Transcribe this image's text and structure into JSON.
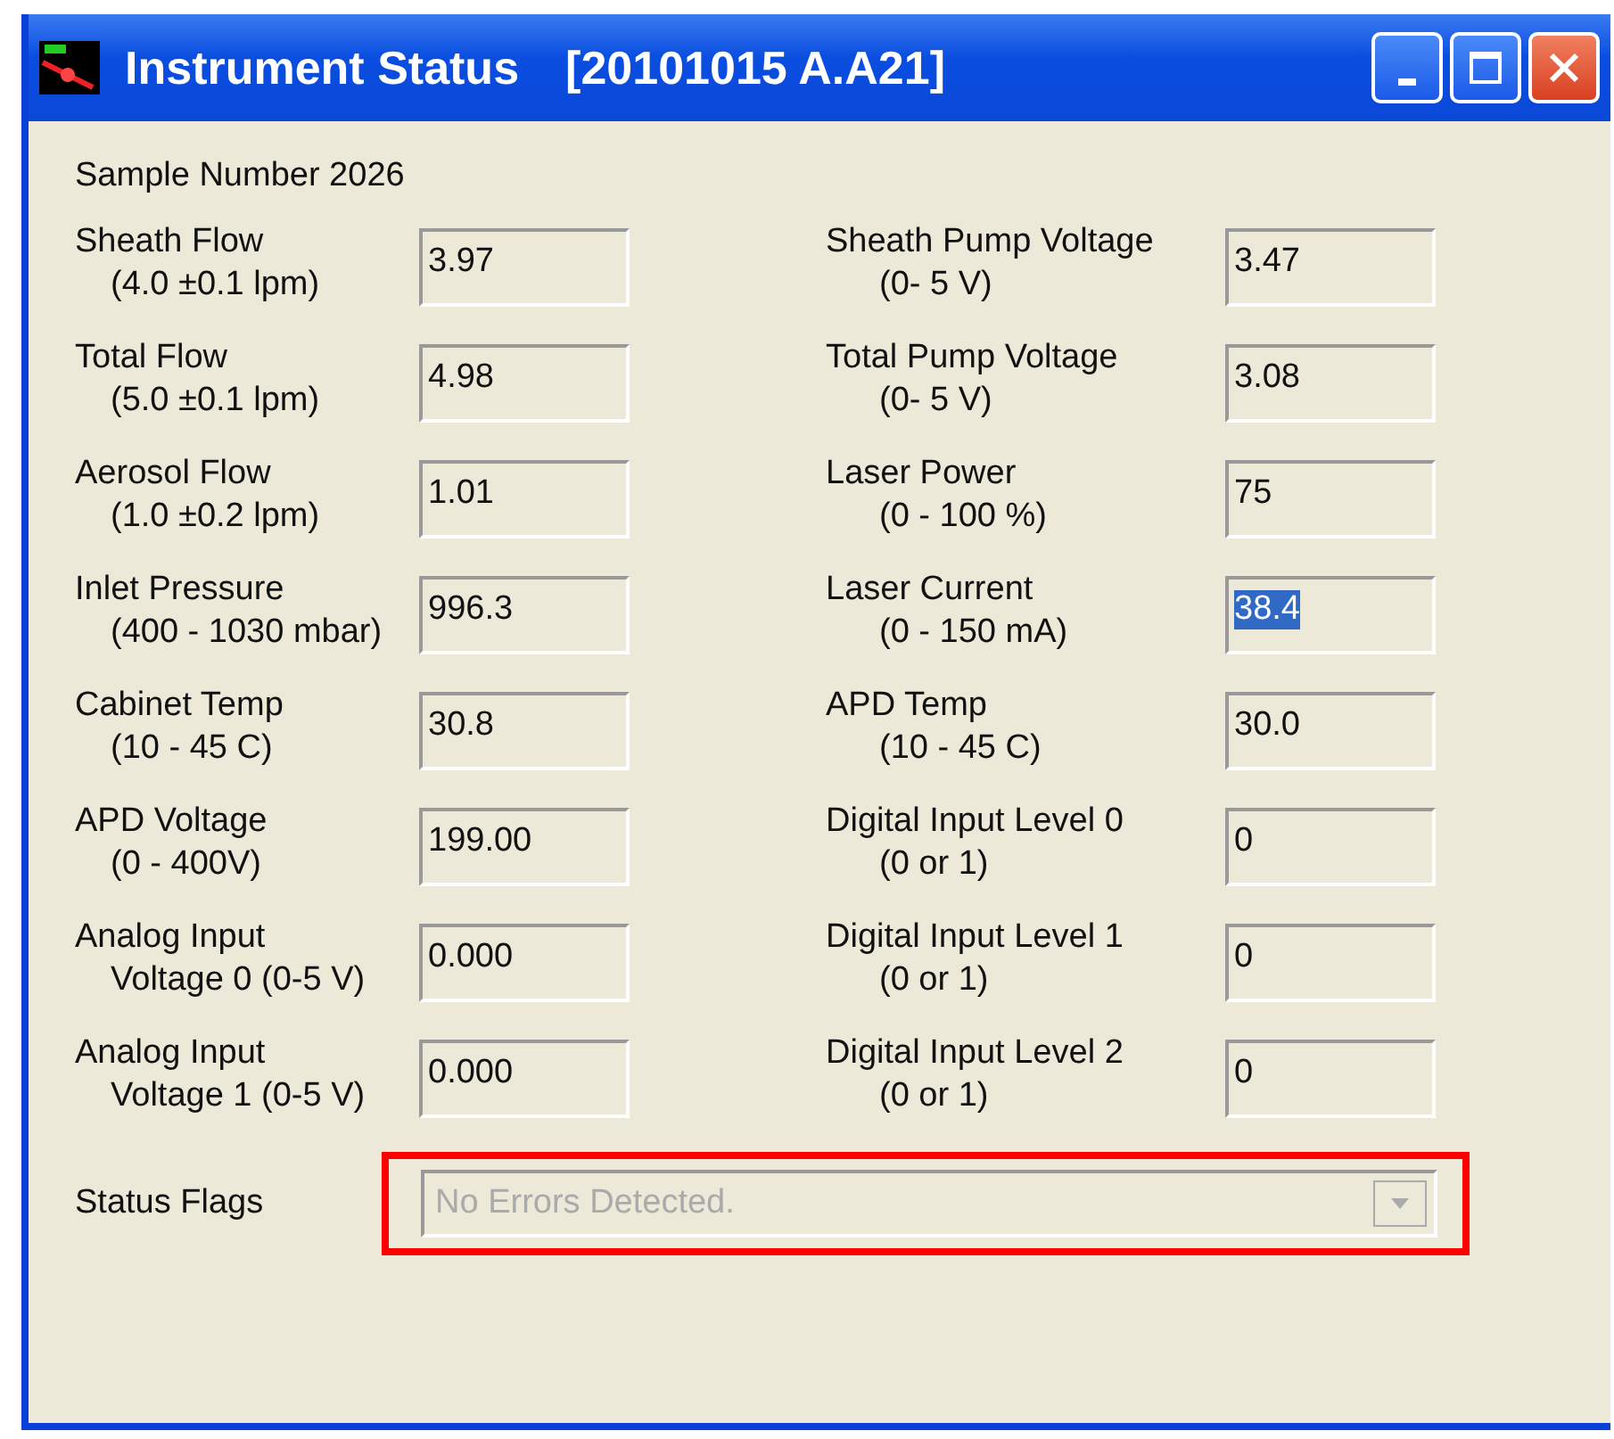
{
  "window": {
    "title": "Instrument Status",
    "subtitle": "[20101015 A.A21]"
  },
  "sample_number": "Sample Number 2026",
  "left_fields": [
    {
      "label": "Sheath Flow",
      "range": "(4.0 ±0.1 lpm)",
      "value": "3.97",
      "selected": false
    },
    {
      "label": "Total Flow",
      "range": "(5.0 ±0.1 lpm)",
      "value": "4.98",
      "selected": false
    },
    {
      "label": "Aerosol Flow",
      "range": "(1.0 ±0.2 lpm)",
      "value": "1.01",
      "selected": false
    },
    {
      "label": "Inlet Pressure",
      "range": "(400 - 1030 mbar)",
      "value": "996.3",
      "selected": false
    },
    {
      "label": "Cabinet Temp",
      "range": "(10 - 45 C)",
      "value": "30.8",
      "selected": false
    },
    {
      "label": "APD Voltage",
      "range": "(0 - 400V)",
      "value": "199.00",
      "selected": false
    },
    {
      "label": "Analog Input",
      "range": "Voltage 0 (0-5 V)",
      "value": "0.000",
      "selected": false
    },
    {
      "label": "Analog Input",
      "range": "Voltage 1 (0-5 V)",
      "value": "0.000",
      "selected": false
    }
  ],
  "right_fields": [
    {
      "label": "Sheath Pump Voltage",
      "range": "(0- 5 V)",
      "value": "3.47",
      "selected": false
    },
    {
      "label": "Total Pump Voltage",
      "range": "(0- 5 V)",
      "value": "3.08",
      "selected": false
    },
    {
      "label": "Laser Power",
      "range": "(0 - 100 %)",
      "value": "75",
      "selected": false
    },
    {
      "label": "Laser Current",
      "range": "(0 - 150 mA)",
      "value": "38.4",
      "selected": true
    },
    {
      "label": "APD Temp",
      "range": "(10 - 45 C)",
      "value": "30.0",
      "selected": false
    },
    {
      "label": "Digital Input Level 0",
      "range": "(0 or 1)",
      "value": "0",
      "selected": false
    },
    {
      "label": "Digital Input Level 1",
      "range": "(0 or 1)",
      "value": "0",
      "selected": false
    },
    {
      "label": "Digital Input Level 2",
      "range": "(0 or 1)",
      "value": "0",
      "selected": false
    }
  ],
  "status_flags": {
    "label": "Status Flags",
    "value": "No Errors Detected.",
    "disabled": true,
    "highlighted": true
  }
}
